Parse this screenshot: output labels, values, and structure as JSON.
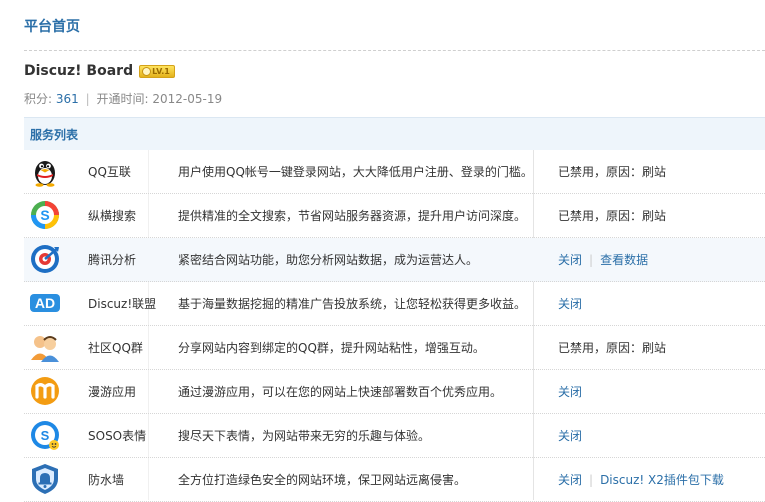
{
  "page_title": "平台首页",
  "site": {
    "name": "Discuz! Board",
    "level": "LV.1",
    "points_label": "积分:",
    "points": "361",
    "separator": "|",
    "opened_label": "开通时间:",
    "opened_date": "2012-05-19"
  },
  "services_title": "服务列表",
  "services": [
    {
      "name": "QQ互联",
      "icon": "qq-penguin-icon",
      "desc": "用户使用QQ帐号一键登录网站，大大降低用户注册、登录的门槛。",
      "status": "已禁用，原因：刷站",
      "actions": []
    },
    {
      "name": "纵横搜索",
      "icon": "soso-search-icon",
      "desc": "提供精准的全文搜索，节省网站服务器资源，提升用户访问深度。",
      "status": "已禁用，原因：刷站",
      "actions": []
    },
    {
      "name": "腾讯分析",
      "icon": "analytics-icon",
      "desc": "紧密结合网站功能，助您分析网站数据，成为运营达人。",
      "status": "",
      "actions": [
        "关闭",
        "查看数据"
      ]
    },
    {
      "name": "Discuz!联盟",
      "icon": "ad-union-icon",
      "desc": "基于海量数据挖掘的精准广告投放系统，让您轻松获得更多收益。",
      "status": "",
      "actions": [
        "关闭"
      ]
    },
    {
      "name": "社区QQ群",
      "icon": "qq-group-icon",
      "desc": "分享网站内容到绑定的QQ群，提升网站粘性，增强互动。",
      "status": "已禁用，原因：刷站",
      "actions": []
    },
    {
      "name": "漫游应用",
      "icon": "manyou-app-icon",
      "desc": "通过漫游应用，可以在您的网站上快速部署数百个优秀应用。",
      "status": "",
      "actions": [
        "关闭"
      ]
    },
    {
      "name": "SOSO表情",
      "icon": "soso-emoticon-icon",
      "desc": "搜尽天下表情，为网站带来无穷的乐趣与体验。",
      "status": "",
      "actions": [
        "关闭"
      ]
    },
    {
      "name": "防水墙",
      "icon": "shield-bell-icon",
      "desc": "全方位打造绿色安全的网站环境，保卫网站远离侵害。",
      "status": "",
      "actions": [
        "关闭",
        "Discuz! X2插件包下载"
      ]
    }
  ],
  "colors": {
    "accent": "#2b6fa8",
    "header_bg": "#eef5fb"
  }
}
